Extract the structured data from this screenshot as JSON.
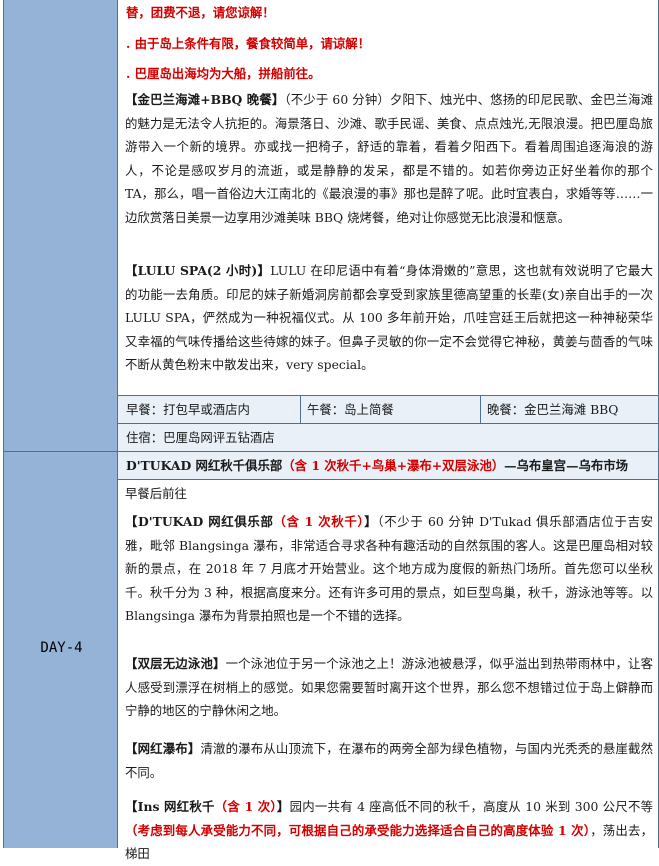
{
  "day3": {
    "notes": [
      "替，团费不退，请您谅解！",
      ". 由于岛上条件有限，餐食较简单，请谅解！",
      ". 巴厘岛出海均为大船，拼船前往。"
    ],
    "paragraphs": [
      {
        "title": "【金巴兰海滩+BBQ 晚餐】",
        "text": "（不少于 60 分钟）夕阳下、烛光中、悠扬的印尼民歌、金巴兰海滩的魅力是无法令人抗拒的。海景落日、沙滩、歌手民谣、美食、点点烛光,无限浪漫。把巴厘岛旅游带入一个新的境界。亦或找一把椅子，舒适的靠着，看着夕阳西下。看着周围追逐海浪的游人，不论是感叹岁月的流逝，或是静静的发呆，都是不错的。如若你旁边正好坐着你的那个 TA，那么，唱一首俗边大江南北的《最浪漫的事》那也是醉了呢。此时宜表白，求婚等等……一边欣赏落日美景一边享用沙滩美味 BBQ 烧烤餐，绝对让你感觉无比浪漫和惬意。"
      },
      {
        "title": "【LULU SPA(2 小时)】",
        "text": "LULU 在印尼语中有着“身体滑嫩的”意思，这也就有效说明了它最大的功能一去角质。印尼的妹子新婚洞房前都会享受到家族里德高望重的长辈(女)亲自出手的一次 LULU SPA，俨然成为一种祝福仪式。从 100 多年前开始，爪哇宫廷王后就把这一种神秘荣华又幸福的气味传播给这些待嫁的妹子。但鼻子灵敏的你一定不会觉得它神秘，黄姜与茴香的气味不断从黄色粉末中散发出来，very special。"
      }
    ],
    "meals": {
      "breakfast": "早餐：打包早或酒店内",
      "lunch": "午餐：岛上简餐",
      "dinner": "晚餐：金巴兰海滩 BBQ"
    },
    "accommodation": "住宿：巴厘岛网评五钻酒店"
  },
  "day4": {
    "label": "DAY-4",
    "header": {
      "part1": "D'TUKAD 网红秋千俱乐部",
      "part2": "（含 1 次秋千+鸟巢+瀑布+双层泳池）",
      "part3": "—乌布皇宫—乌布市场"
    },
    "intro": "早餐后前往",
    "paragraphs": [
      {
        "title_a": "【D'TUKAD 网红俱乐部",
        "title_b": "（含 1 次秋千）",
        "title_c": "】",
        "text": "（不少于 60 分钟 D'Tukad 俱乐部酒店位于吉安雅，毗邻 Blangsinga 瀑布，非常适合寻求各种有趣活动的自然氛围的客人。这是巴厘岛相对较新的景点，在 2018 年 7 月底才开始营业。这个地方成为度假的新热门场所。首先您可以坐秋千。秋千分为 3 种，根据高度来分。还有许多可用的景点，如巨型鸟巢，秋千，游泳池等等。以 Blangsinga 瀑布为背景拍照也是一个不错的选择。"
      },
      {
        "title": "【双层无边泳池】",
        "text": "一个泳池位于另一个泳池之上！游泳池被悬浮，似乎溢出到热带雨林中，让客人感受到漂浮在树梢上的感觉。如果您需要暂时离开这个世界，那么您不想错过位于岛上僻静而宁静的地区的宁静休闲之地。"
      },
      {
        "title": "【网红瀑布】",
        "text": "清澈的瀑布从山顶流下，在瀑布的两旁全部为绿色植物，与国内光秃秃的悬崖截然不同。"
      },
      {
        "title_a": "【Ins 网红秋千",
        "title_b": "（含 1 次）",
        "title_c": "】",
        "text": "园内一共有 4 座高低不同的秋千，高度从 10 米到 300 公尺不等",
        "warning": "（考虑到每人承受能力不同，可根据自己的承受能力选择适合自己的高度体验 1 次）",
        "tail": "，荡出去，梯田"
      }
    ]
  }
}
